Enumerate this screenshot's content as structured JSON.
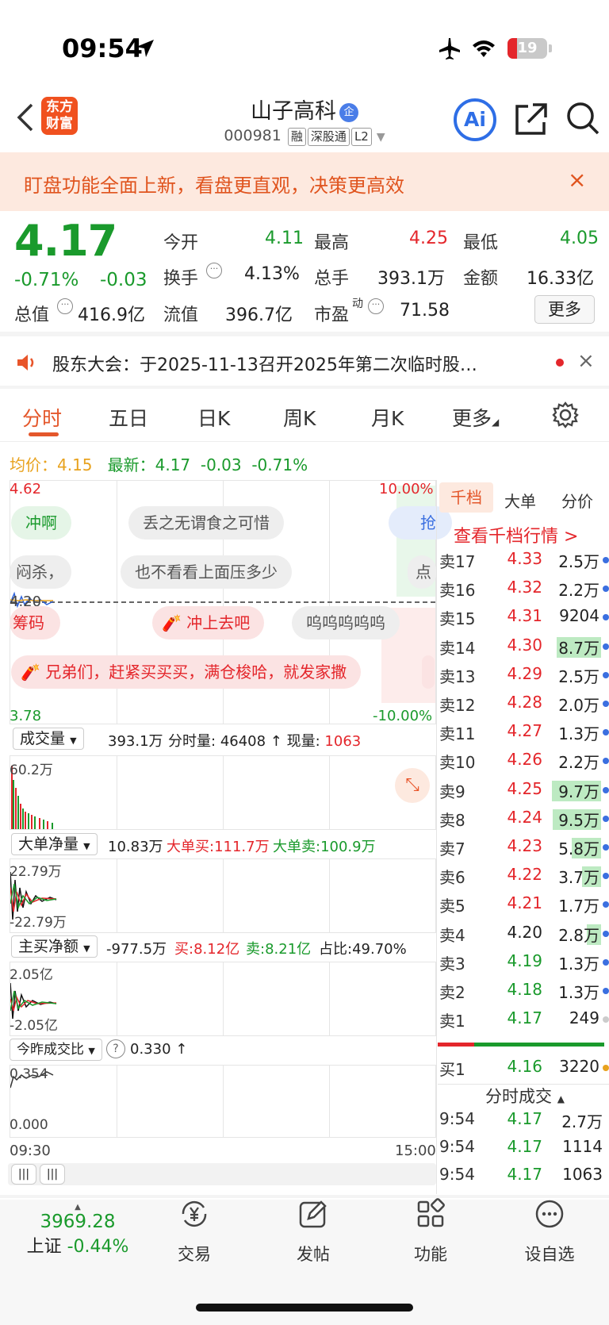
{
  "status_bar": {
    "time": "09:54",
    "battery": "19"
  },
  "header": {
    "logo_text": "东方财富",
    "title": "山子高科",
    "title_badge": "企",
    "code": "000981",
    "tags": [
      "融",
      "深股通",
      "L2"
    ]
  },
  "banner": {
    "text": "盯盘功能全面上新，看盘更直观，决策更高效",
    "close": "×"
  },
  "quote": {
    "price": "4.17",
    "change_pct": "-0.71%",
    "change": "-0.03",
    "open_label": "今开",
    "open": "4.11",
    "high_label": "最高",
    "high": "4.25",
    "low_label": "最低",
    "low": "4.05",
    "turnover_label": "换手",
    "turnover": "4.13%",
    "volume_label": "总手",
    "volume": "393.1万",
    "amount_label": "金额",
    "amount": "16.33亿",
    "mktcap_label": "总值",
    "mktcap": "416.9亿",
    "float_label": "流值",
    "float": "396.7亿",
    "pe_label": "市盈",
    "pe_sup": "动",
    "pe": "71.58",
    "more": "更多"
  },
  "notice": {
    "text": "股东大会：于2025-11-13召开2025年第二次临时股…"
  },
  "tabs": [
    "分时",
    "五日",
    "日K",
    "周K",
    "月K",
    "更多"
  ],
  "chart": {
    "avg_label": "均价：",
    "avg": "4.15",
    "latest_label": "最新：",
    "latest": "4.17",
    "latest_chg": "-0.03",
    "latest_pct": "-0.71%",
    "y_top": "4.62",
    "y_bottom": "3.78",
    "y_mid": "4.20",
    "pct_top": "10.00%",
    "pct_bottom": "-10.00%",
    "bubbles": [
      "冲啊",
      "丢之无谓食之可惜",
      "也不看看上面压多少",
      "冲上去吧",
      "呜呜呜呜呜",
      "兄弟们，赶紧买买买，满仓梭哈，就发家撒",
      "筹码",
      "闷杀，",
      "抢",
      "点"
    ],
    "time_start": "09:30",
    "time_end": "15:00"
  },
  "volume_panel": {
    "label": "成交量",
    "total": "393.1万",
    "minute_label": "分时量:",
    "minute": "46408",
    "now_label": "现量:",
    "now": "1063",
    "max": "60.2万"
  },
  "bigorder_panel": {
    "label": "大单净量",
    "value": "10.83万",
    "buy_label": "大单买:",
    "buy": "111.7万",
    "sell_label": "大单卖:",
    "sell": "100.9万",
    "max": "22.79万",
    "min": "-22.79万"
  },
  "mainbuy_panel": {
    "label": "主买净额",
    "value": "-977.5万",
    "buy_label": "买:",
    "buy": "8.12亿",
    "sell_label": "卖:",
    "sell": "8.21亿",
    "ratio_label": "占比:",
    "ratio": "49.70%",
    "max": "2.05亿",
    "min": "-2.05亿"
  },
  "ratio_panel": {
    "label": "今昨成交比",
    "value": "0.330",
    "max": "0.354",
    "min": "0.000"
  },
  "orderbook": {
    "tabs": [
      "千档",
      "大单",
      "分价"
    ],
    "link": "查看千档行情 >",
    "asks": [
      {
        "label": "卖17",
        "price": "4.33",
        "vol": "2.5万",
        "bar": 0
      },
      {
        "label": "卖16",
        "price": "4.32",
        "vol": "2.2万",
        "bar": 0
      },
      {
        "label": "卖15",
        "price": "4.31",
        "vol": "9204",
        "bar": 0
      },
      {
        "label": "卖14",
        "price": "4.30",
        "vol": "8.7万",
        "bar": 0.9
      },
      {
        "label": "卖13",
        "price": "4.29",
        "vol": "2.5万",
        "bar": 0
      },
      {
        "label": "卖12",
        "price": "4.28",
        "vol": "2.0万",
        "bar": 0
      },
      {
        "label": "卖11",
        "price": "4.27",
        "vol": "1.3万",
        "bar": 0
      },
      {
        "label": "卖10",
        "price": "4.26",
        "vol": "2.2万",
        "bar": 0
      },
      {
        "label": "卖9",
        "price": "4.25",
        "vol": "9.7万",
        "bar": 1.0
      },
      {
        "label": "卖8",
        "price": "4.24",
        "vol": "9.5万",
        "bar": 0.98
      },
      {
        "label": "卖7",
        "price": "4.23",
        "vol": "5.8万",
        "bar": 0.6
      },
      {
        "label": "卖6",
        "price": "4.22",
        "vol": "3.7万",
        "bar": 0.38
      },
      {
        "label": "卖5",
        "price": "4.21",
        "vol": "1.7万",
        "bar": 0
      },
      {
        "label": "卖4",
        "price": "4.20",
        "vol": "2.8万",
        "bar": 0.29
      },
      {
        "label": "卖3",
        "price": "4.19",
        "vol": "1.3万",
        "bar": 0
      },
      {
        "label": "卖2",
        "price": "4.18",
        "vol": "1.3万",
        "bar": 0
      },
      {
        "label": "卖1",
        "price": "4.17",
        "vol": "249",
        "bar": 0
      }
    ],
    "bid": {
      "label": "买1",
      "price": "4.16",
      "vol": "3220"
    },
    "trades_title": "分时成交",
    "trades": [
      {
        "time": "9:54",
        "price": "4.17",
        "vol": "2.7万"
      },
      {
        "time": "9:54",
        "price": "4.17",
        "vol": "1114"
      },
      {
        "time": "9:54",
        "price": "4.17",
        "vol": "1063"
      }
    ]
  },
  "bottom_nav": {
    "index_value": "3969.28",
    "index_name": "上证",
    "index_chg": "-0.44%",
    "items": [
      "交易",
      "发帖",
      "功能",
      "设自选"
    ]
  }
}
